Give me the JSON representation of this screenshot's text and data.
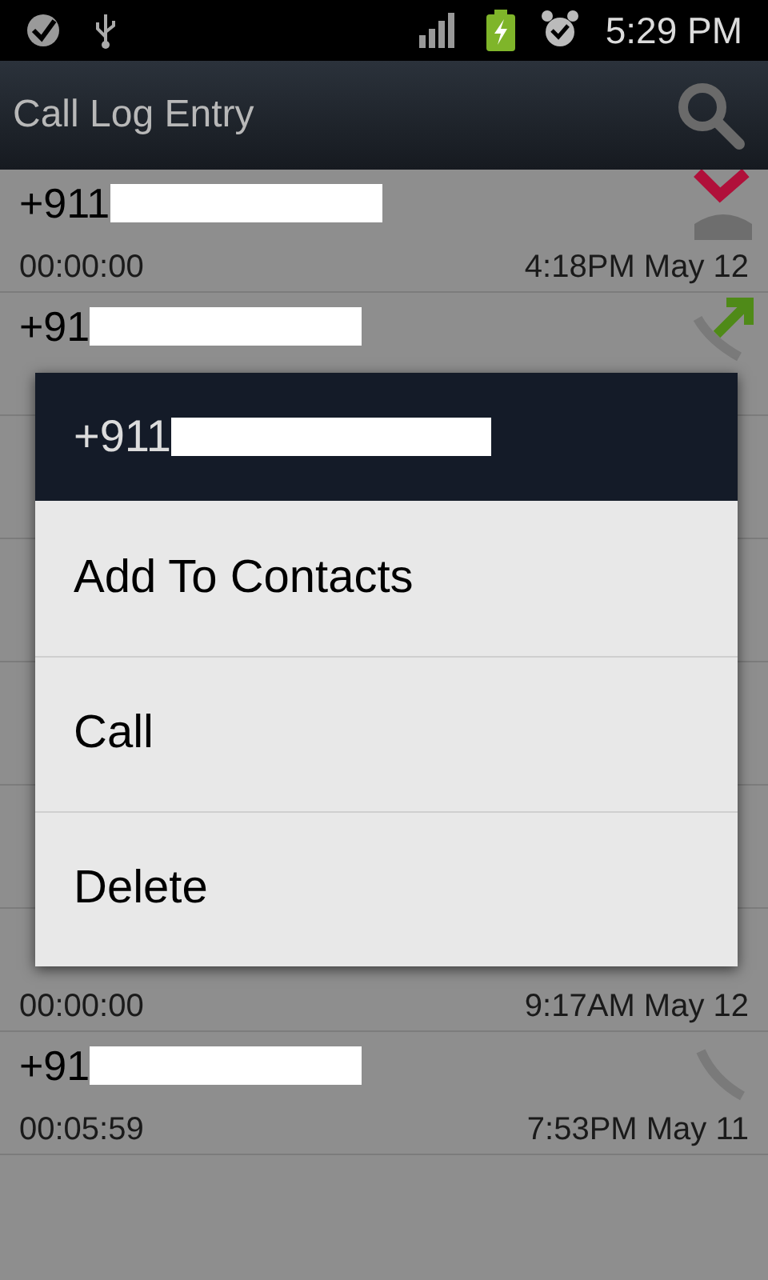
{
  "status_bar": {
    "time": "5:29 PM"
  },
  "action_bar": {
    "title": "Call Log Entry"
  },
  "calls_above": [
    {
      "number": "+911",
      "duration": "00:00:00",
      "when": "4:18PM May 12",
      "kind": "missed"
    },
    {
      "number": "+91",
      "kind": "outgoing"
    }
  ],
  "calls_below": [
    {
      "duration": "00:00:00",
      "when": "9:17AM May 12"
    },
    {
      "number": "+91",
      "duration": "00:05:59",
      "when": "7:53PM May 11",
      "kind": "incoming"
    }
  ],
  "dialog": {
    "title": "+911",
    "items": [
      "Add To Contacts",
      "Call",
      "Delete"
    ]
  }
}
